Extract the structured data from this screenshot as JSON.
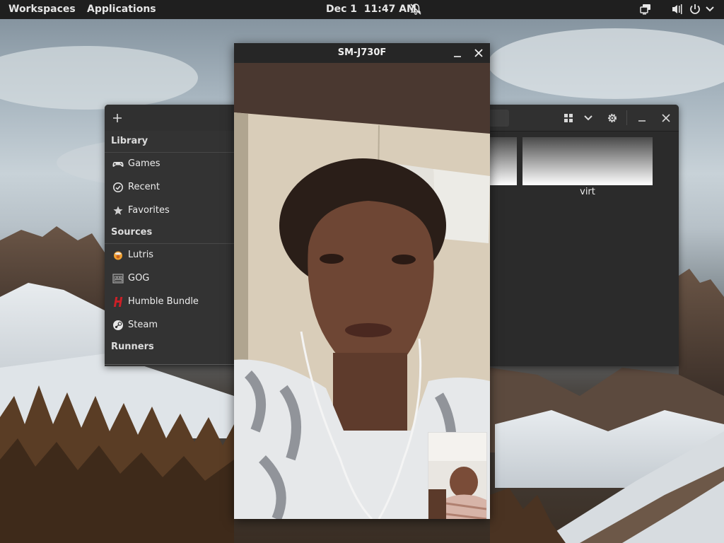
{
  "topbar": {
    "workspaces": "Workspaces",
    "applications": "Applications",
    "date": "Dec 1",
    "time": "11:47 AM",
    "icons": [
      "notifications-off-icon",
      "display-icon",
      "audio-icon",
      "power-icon",
      "chevron-down-icon"
    ]
  },
  "lutris": {
    "add_icon": "plus-icon",
    "sidebar": {
      "library_header": "Library",
      "library_items": [
        {
          "label": "Games",
          "icon": "gamepad-icon"
        },
        {
          "label": "Recent",
          "icon": "clock-icon"
        },
        {
          "label": "Favorites",
          "icon": "star-icon"
        }
      ],
      "sources_header": "Sources",
      "source_items": [
        {
          "label": "Lutris",
          "icon": "lutris-icon"
        },
        {
          "label": "GOG",
          "icon": "gog-icon"
        },
        {
          "label": "Humble Bundle",
          "icon": "humble-bundle-icon"
        },
        {
          "label": "Steam",
          "icon": "steam-icon"
        }
      ],
      "runners_header": "Runners"
    },
    "header_buttons": [
      "grid-view-icon",
      "chevron-down-icon",
      "gear-icon",
      "minimize-icon",
      "close-icon"
    ],
    "games": [
      {
        "label": ""
      },
      {
        "label": "virt"
      }
    ]
  },
  "video_window": {
    "title": "SM-J730F",
    "buttons": [
      "minimize-icon",
      "close-icon"
    ]
  },
  "colors": {
    "topbar_bg": "#1f1f1f",
    "window_bg": "#2b2b2b",
    "sidebar_bg": "#333333",
    "humble_red": "#cc2027"
  }
}
